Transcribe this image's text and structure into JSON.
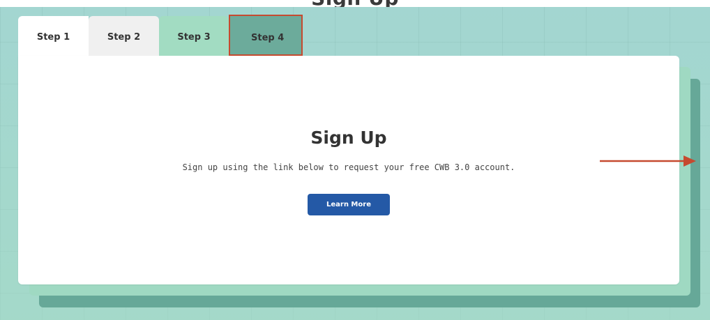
{
  "header": {
    "cut_heading": "Sign Up"
  },
  "tabs": [
    {
      "label": "Step 1"
    },
    {
      "label": "Step 2"
    },
    {
      "label": "Step 3"
    },
    {
      "label": "Step 4"
    }
  ],
  "card": {
    "title": "Sign Up",
    "description": "Sign up using the link below to request your free CWB 3.0 account.",
    "button_label": "Learn More"
  },
  "annotation": {
    "highlight_color": "#c64a2f",
    "arrow_icon": "arrow-right-icon"
  },
  "colors": {
    "button": "#2459a6",
    "tab_active": "#6cab9b",
    "tab_step3": "#a2dcc2",
    "background": "#a3d6d1"
  }
}
